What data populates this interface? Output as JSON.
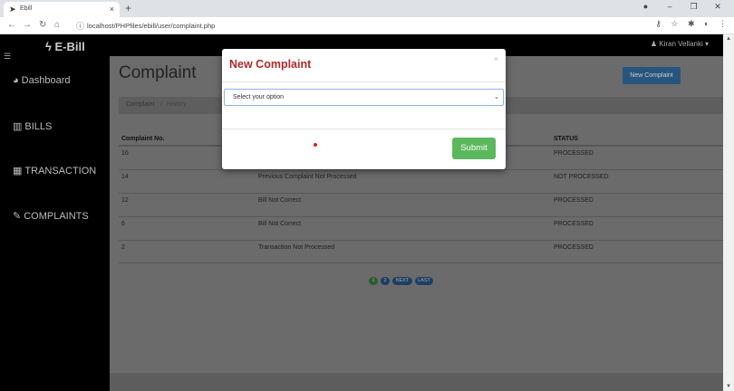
{
  "browser": {
    "tab_title": "Ebill",
    "url": "localhost/PHPfiles/ebill/user/complaint.php"
  },
  "app": {
    "brand": "E-Bill",
    "user": "Kiran Vellanki",
    "sidebar": {
      "items": [
        {
          "label": "Dashboard",
          "icon": "dashboard-icon"
        },
        {
          "label": "BILLS",
          "icon": "bar-chart-icon"
        },
        {
          "label": "TRANSACTION",
          "icon": "table-icon"
        },
        {
          "label": "COMPLAINTS",
          "icon": "edit-icon"
        }
      ]
    }
  },
  "page": {
    "title": "Complaint",
    "new_button": "New Complaint",
    "breadcrumb": [
      "Complaint",
      "History"
    ],
    "table": {
      "headers": [
        "Complaint No.",
        "",
        "STATUS"
      ],
      "rows": [
        {
          "no": "16",
          "desc": "",
          "status": "PROCESSED"
        },
        {
          "no": "14",
          "desc": "Previous Complaint Not Processed",
          "status": "NOT PROCESSED"
        },
        {
          "no": "12",
          "desc": "Bill Not Correct",
          "status": "PROCESSED"
        },
        {
          "no": "6",
          "desc": "Bill Not Correct",
          "status": "PROCESSED"
        },
        {
          "no": "2",
          "desc": "Transaction Not Processed",
          "status": "PROCESSED"
        }
      ]
    },
    "pager": {
      "pages": [
        "1",
        "2"
      ],
      "next": "NEXT",
      "last": "LAST"
    }
  },
  "modal": {
    "title": "New Complaint",
    "close": "×",
    "select_value": "Select your option",
    "submit": "Submit"
  }
}
